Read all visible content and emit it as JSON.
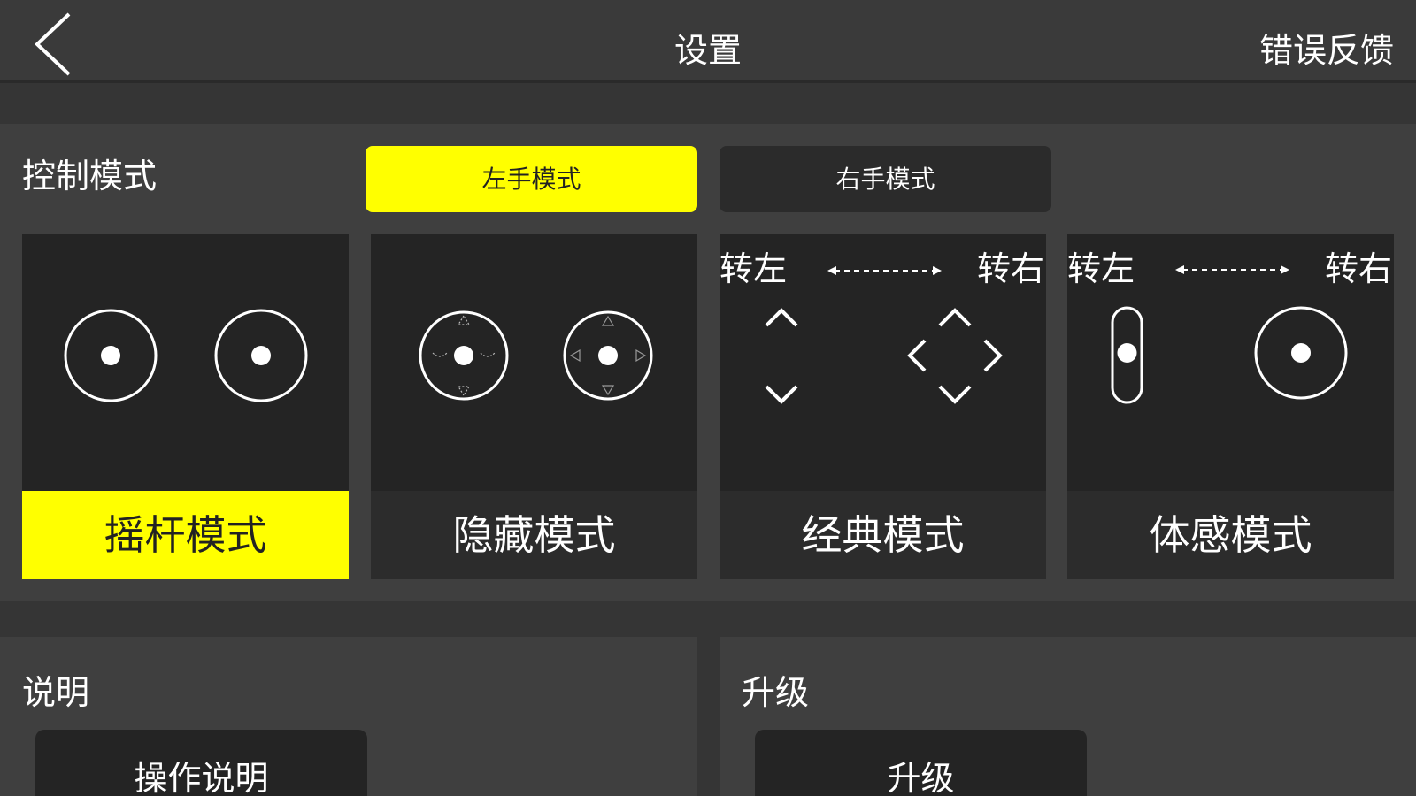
{
  "header": {
    "title": "设置",
    "feedback_label": "错误反馈"
  },
  "control": {
    "label": "控制模式",
    "hand_modes": [
      {
        "label": "左手模式",
        "active": true
      },
      {
        "label": "右手模式",
        "active": false
      }
    ],
    "modes": [
      {
        "label": "摇杆模式",
        "selected": true
      },
      {
        "label": "隐藏模式",
        "selected": false
      },
      {
        "label": "经典模式",
        "selected": false,
        "turn_left": "转左",
        "turn_right": "转右"
      },
      {
        "label": "体感模式",
        "selected": false,
        "turn_left": "转左",
        "turn_right": "转右"
      }
    ]
  },
  "instructions": {
    "label": "说明",
    "button_label": "操作说明"
  },
  "upgrade": {
    "label": "升级",
    "button_label": "升级"
  },
  "colors": {
    "accent": "#ffff00",
    "background": "#353535",
    "panel": "#3f3f3f",
    "card": "#242424"
  }
}
